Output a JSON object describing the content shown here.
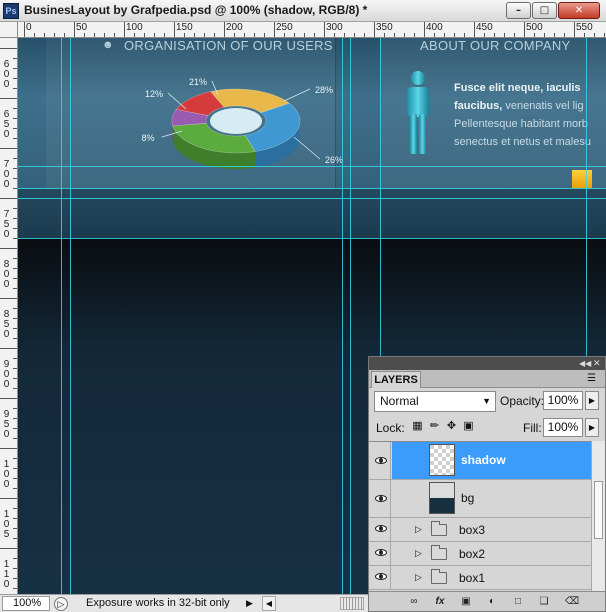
{
  "window": {
    "title": "BusinesLayout by Grafpedia.psd @ 100% (shadow, RGB/8) *",
    "app_icon": "Ps",
    "minimize_glyph": "–",
    "maximize_glyph": "□",
    "close_glyph": "✕"
  },
  "rulers": {
    "top_labels": [
      "0",
      "50",
      "100",
      "150",
      "200",
      "250",
      "300",
      "350",
      "400",
      "450",
      "500",
      "550"
    ],
    "left_labels": [
      "6\n0\n0",
      "6\n5\n0",
      "7\n0\n0",
      "7\n5\n0",
      "8\n0\n0",
      "8\n5\n0",
      "9\n0\n0",
      "9\n5\n0",
      "1\n0\n0",
      "1\n0\n5",
      "1\n1\n0"
    ]
  },
  "canvas": {
    "left_heading": "ORGANISATION OF OUR USERS",
    "right_heading": "ABOUT OUR COMPANY",
    "body_lines": [
      {
        "bold": "Fusce elit neque, iaculis",
        "rest": ""
      },
      {
        "bold": "faucibus,",
        "rest": " venenatis vel lig"
      },
      {
        "bold": "",
        "rest": "Pellentesque habitant morb"
      },
      {
        "bold": "",
        "rest": "senectus et netus et malesu"
      }
    ]
  },
  "chart_data": {
    "type": "pie",
    "title": "",
    "categories": [
      "12%",
      "21%",
      "28%",
      "26%",
      "8%"
    ],
    "values": [
      12,
      21,
      28,
      26,
      8
    ],
    "labels": [
      "12%",
      "21%",
      "28%",
      "26%",
      "8%"
    ],
    "colors": [
      "#9a5ab0",
      "#d63b3b",
      "#e9b84a",
      "#3f98d2",
      "#5cab3f",
      "#e99a2f"
    ],
    "style": "3d-donut"
  },
  "statusbar": {
    "zoom": "100%",
    "message": "Exposure works in 32-bit only",
    "arrow_glyph": "▶",
    "scroll_left_glyph": "◀"
  },
  "layers_panel": {
    "tab_label": "LAYERS",
    "blend_mode": "Normal",
    "opacity_label": "Opacity:",
    "opacity_value": "100%",
    "lock_label": "Lock:",
    "fill_label": "Fill:",
    "fill_value": "100%",
    "layers": [
      {
        "name": "shadow",
        "type": "layer",
        "selected": true,
        "visible": true
      },
      {
        "name": "bg",
        "type": "layer",
        "selected": false,
        "visible": true
      },
      {
        "name": "box3",
        "type": "group",
        "selected": false,
        "visible": true
      },
      {
        "name": "box2",
        "type": "group",
        "selected": false,
        "visible": true
      },
      {
        "name": "box1",
        "type": "group",
        "selected": false,
        "visible": true
      }
    ],
    "selected_color": "#3c9cfb"
  }
}
